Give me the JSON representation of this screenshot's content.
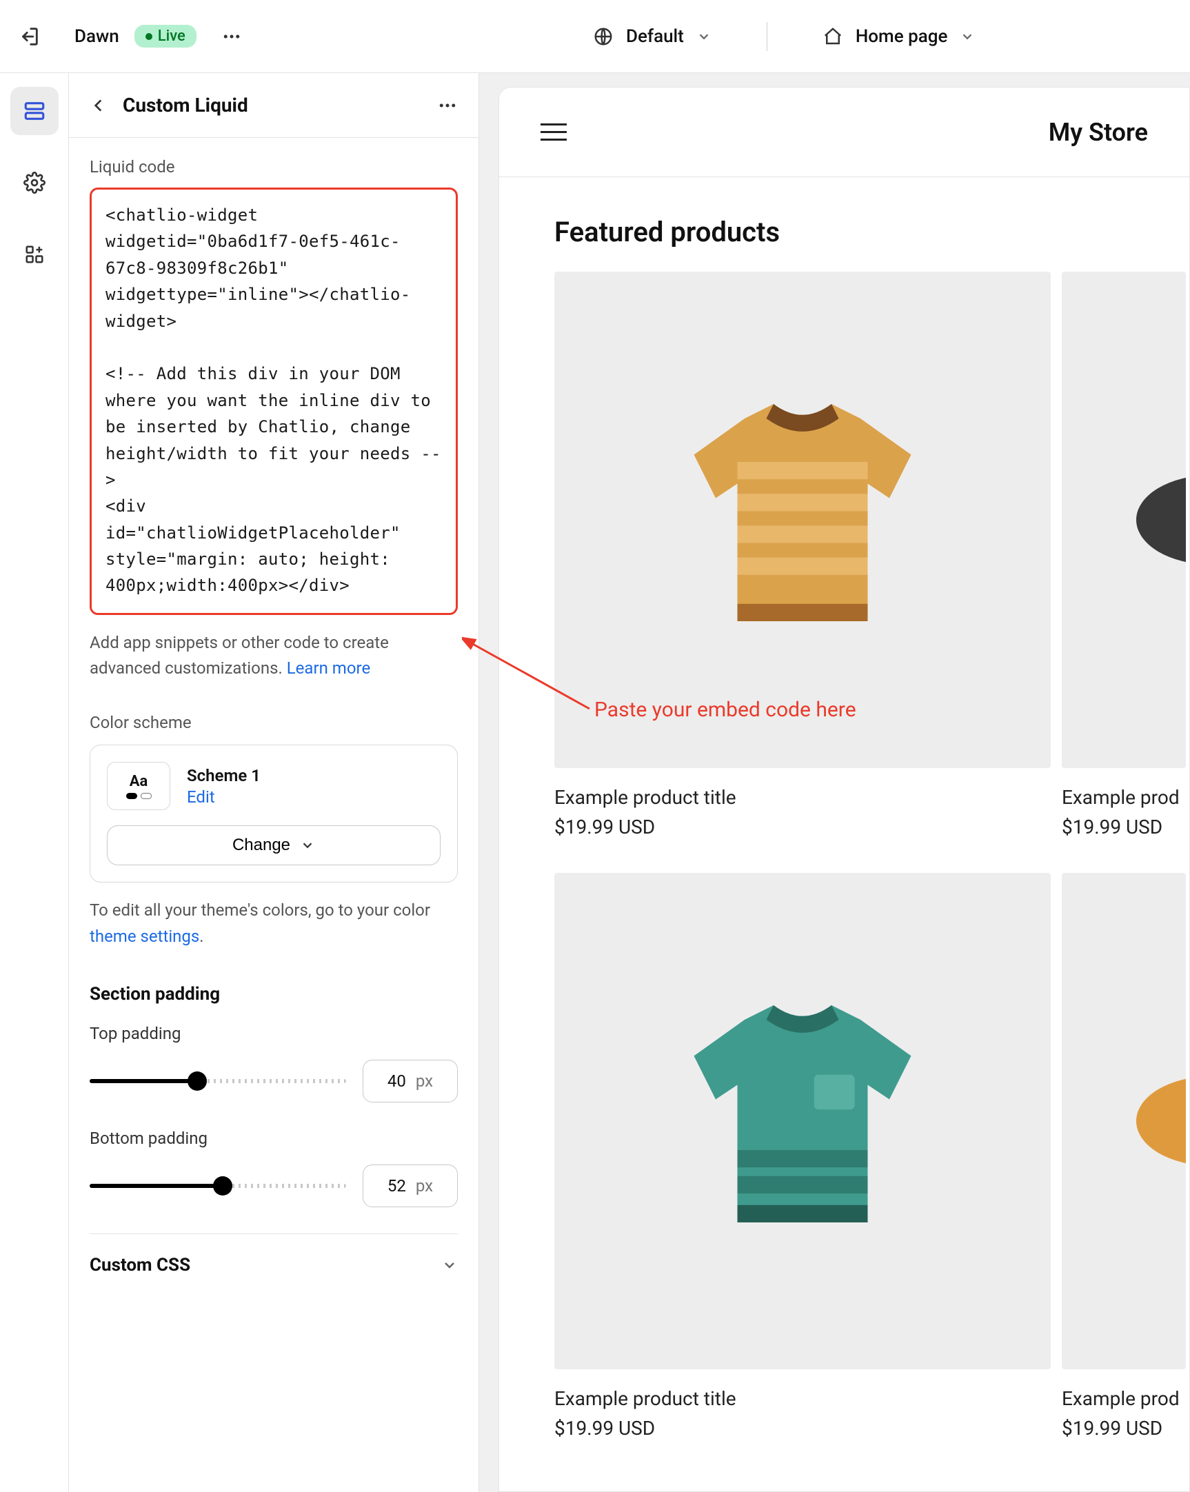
{
  "topbar": {
    "theme_name": "Dawn",
    "live_label": "Live",
    "viewport_label": "Default",
    "page_label": "Home page"
  },
  "sidebar": {
    "title": "Custom Liquid",
    "liquid_label": "Liquid code",
    "code_value": "<chatlio-widget widgetid=\"0ba6d1f7-0ef5-461c-67c8-98309f8c26b1\" widgettype=\"inline\"></chatlio-widget>\n\n<!-- Add this div in your DOM where you want the inline div to be inserted by Chatlio, change height/width to fit your needs -->\n<div id=\"chatlioWidgetPlaceholder\" style=\"margin: auto; height: 400px;width:400px></div>",
    "help_text": "Add app snippets or other code to create advanced customizations. ",
    "learn_more": "Learn more",
    "color_scheme_label": "Color scheme",
    "scheme_name": "Scheme 1",
    "edit_label": "Edit",
    "change_label": "Change",
    "theme_colors_text_a": "To edit all your theme's colors, go to your color ",
    "theme_settings_link": "theme settings",
    "theme_colors_text_b": ".",
    "section_padding_heading": "Section padding",
    "top_padding_label": "Top padding",
    "top_padding_value": "40",
    "top_padding_unit": "px",
    "bottom_padding_label": "Bottom padding",
    "bottom_padding_value": "52",
    "bottom_padding_unit": "px",
    "custom_css_label": "Custom CSS"
  },
  "preview": {
    "store_name": "My Store",
    "featured_heading": "Featured products",
    "products": [
      {
        "title": "Example product title",
        "price": "$19.99 USD"
      },
      {
        "title": "Example prod",
        "price": "$19.99 USD"
      },
      {
        "title": "Example product title",
        "price": "$19.99 USD"
      },
      {
        "title": "Example prod",
        "price": "$19.99 USD"
      }
    ]
  },
  "annotation": {
    "text": "Paste your embed code here"
  },
  "colors": {
    "highlight": "#eb3a2a",
    "link": "#1c6ae4",
    "live_bg": "#b3f0cf"
  }
}
